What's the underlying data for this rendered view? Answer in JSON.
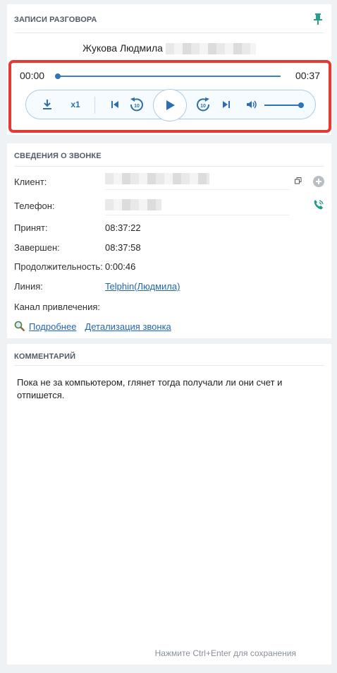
{
  "recordings": {
    "title": "ЗАПИСИ РАЗГОВОРА",
    "caller_name": "Жукова Людмила",
    "pin_icon": "pin-icon",
    "player": {
      "current_time": "00:00",
      "duration": "00:37",
      "progress": 0,
      "speed_label": "x1",
      "volume": 1,
      "accent_color": "#2f74b5",
      "highlight_color": "#e53935",
      "icons": [
        "download-icon",
        "skip-to-start-icon",
        "rewind-10-icon",
        "play-icon",
        "forward-10-icon",
        "skip-to-end-icon",
        "volume-icon"
      ]
    }
  },
  "call_info": {
    "title": "СВЕДЕНИЯ О ЗВОНКЕ",
    "client_label": "Клиент:",
    "phone_label": "Телефон:",
    "accepted_label": "Принят:",
    "accepted_value": "08:37:22",
    "finished_label": "Завершен:",
    "finished_value": "08:37:58",
    "duration_label": "Продолжительность:",
    "duration_value": "0:00:46",
    "line_label": "Линия:",
    "line_value": "Telphin(Людмила)",
    "channel_label": "Канал привлечения:",
    "more_link": "Подробнее",
    "details_link": "Детализация звонка"
  },
  "comments": {
    "title": "КОММЕНТАРИЙ",
    "text": "Пока не за компьютером, глянет тогда получали ли они счет и отпишется.",
    "save_hint": "Нажмите Ctrl+Enter для сохранения"
  }
}
